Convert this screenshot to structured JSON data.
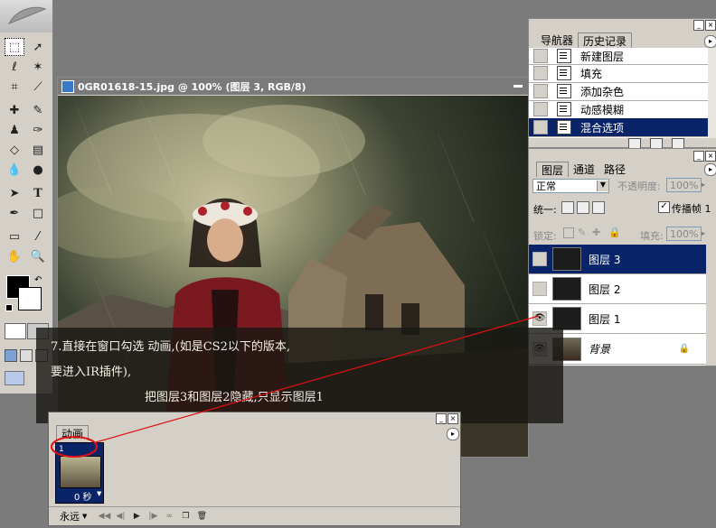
{
  "document": {
    "title": "0GR01618-15.jpg @ 100% (图层 3, RGB/8)"
  },
  "history_panel": {
    "tabs": [
      "导航器",
      "历史记录"
    ],
    "items": [
      {
        "label": "新建图层"
      },
      {
        "label": "填充"
      },
      {
        "label": "添加杂色"
      },
      {
        "label": "动感模糊"
      },
      {
        "label": "混合选项",
        "selected": true
      }
    ]
  },
  "layers_panel": {
    "tabs": [
      "图层",
      "通道",
      "路径"
    ],
    "blend_mode": "正常",
    "opacity_label": "不透明度:",
    "opacity_value": "100%",
    "unify_label": "统一:",
    "propagate_label": "传播帧 1",
    "lock_label": "锁定:",
    "fill_label": "填充:",
    "fill_value": "100%",
    "layers": [
      {
        "name": "图层 3",
        "selected": true,
        "visible": false
      },
      {
        "name": "图层 2",
        "selected": false,
        "visible": false
      },
      {
        "name": "图层 1",
        "selected": false,
        "visible": true
      },
      {
        "name": "背景",
        "selected": false,
        "visible": true,
        "locked": true
      }
    ]
  },
  "caption": {
    "line1": "7.直接在窗口勾选 动画,(如是CS2以下的版本,",
    "line2": "要进入IR插件),",
    "line3": "把图层3和图层2隐藏,只显示图层1"
  },
  "animation_panel": {
    "tab": "动画",
    "frame_number": "1",
    "frame_delay": "0 秒",
    "loop": "永远"
  },
  "colors": {
    "selection_blue": "#0a246a",
    "panel_bg": "#d4d0c8",
    "workspace_bg": "#7b7b7b",
    "annotation_red": "#e01010"
  }
}
